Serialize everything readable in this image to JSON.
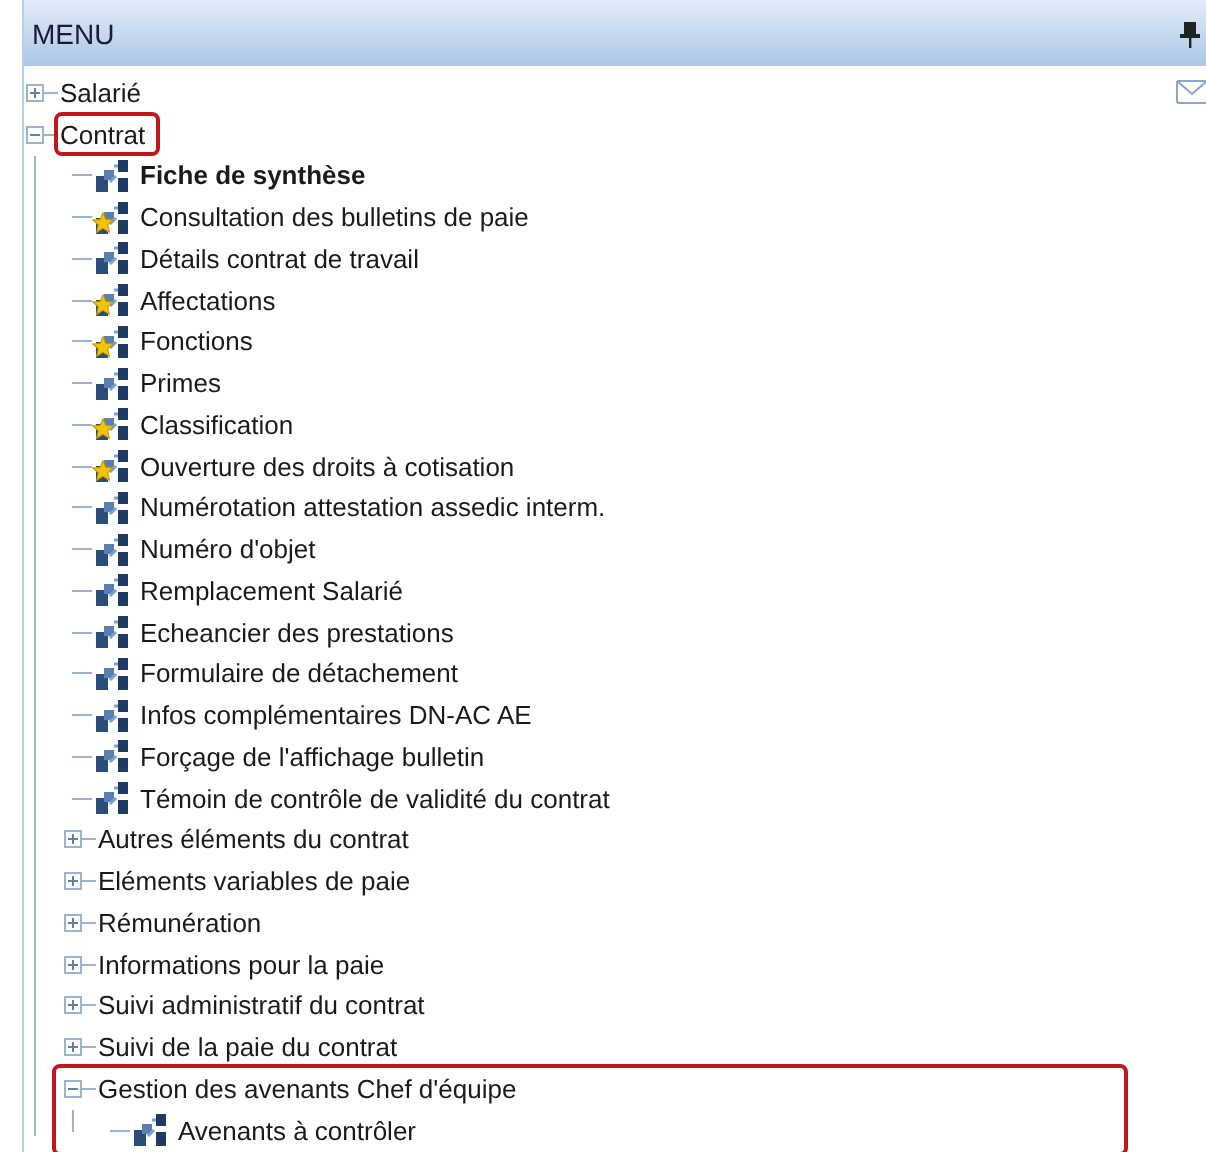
{
  "panel": {
    "title": "MENU"
  },
  "tree": [
    {
      "label": "Salarié",
      "expanded": false
    },
    {
      "label": "Contrat",
      "expanded": true,
      "highlighted": true,
      "children": [
        {
          "label": "Fiche de synthèse",
          "starred": false,
          "bold": true
        },
        {
          "label": "Consultation des bulletins de paie",
          "starred": true
        },
        {
          "label": "Détails contrat de travail",
          "starred": false
        },
        {
          "label": "Affectations",
          "starred": true
        },
        {
          "label": "Fonctions",
          "starred": true
        },
        {
          "label": "Primes",
          "starred": false
        },
        {
          "label": "Classification",
          "starred": true
        },
        {
          "label": "Ouverture des droits à cotisation",
          "starred": true
        },
        {
          "label": "Numérotation attestation assedic interm.",
          "starred": false
        },
        {
          "label": "Numéro d'objet",
          "starred": false
        },
        {
          "label": "Remplacement Salarié",
          "starred": false
        },
        {
          "label": "Echeancier des prestations",
          "starred": false
        },
        {
          "label": "Formulaire de détachement",
          "starred": false
        },
        {
          "label": "Infos complémentaires DN-AC AE",
          "starred": false
        },
        {
          "label": "Forçage de l'affichage bulletin",
          "starred": false
        },
        {
          "label": "Témoin de contrôle de validité du contrat",
          "starred": false
        },
        {
          "label": "Autres éléments du contrat",
          "expanded": false
        },
        {
          "label": "Eléments variables de paie",
          "expanded": false
        },
        {
          "label": "Rémunération",
          "expanded": false
        },
        {
          "label": "Informations pour la paie",
          "expanded": false
        },
        {
          "label": "Suivi administratif du contrat",
          "expanded": false
        },
        {
          "label": "Suivi de la paie du contrat",
          "expanded": false
        },
        {
          "label": "Gestion des avenants Chef d'équipe",
          "expanded": true,
          "group_highlighted": true,
          "children": [
            {
              "label": "Avenants à contrôler",
              "starred": false
            }
          ]
        }
      ]
    }
  ]
}
